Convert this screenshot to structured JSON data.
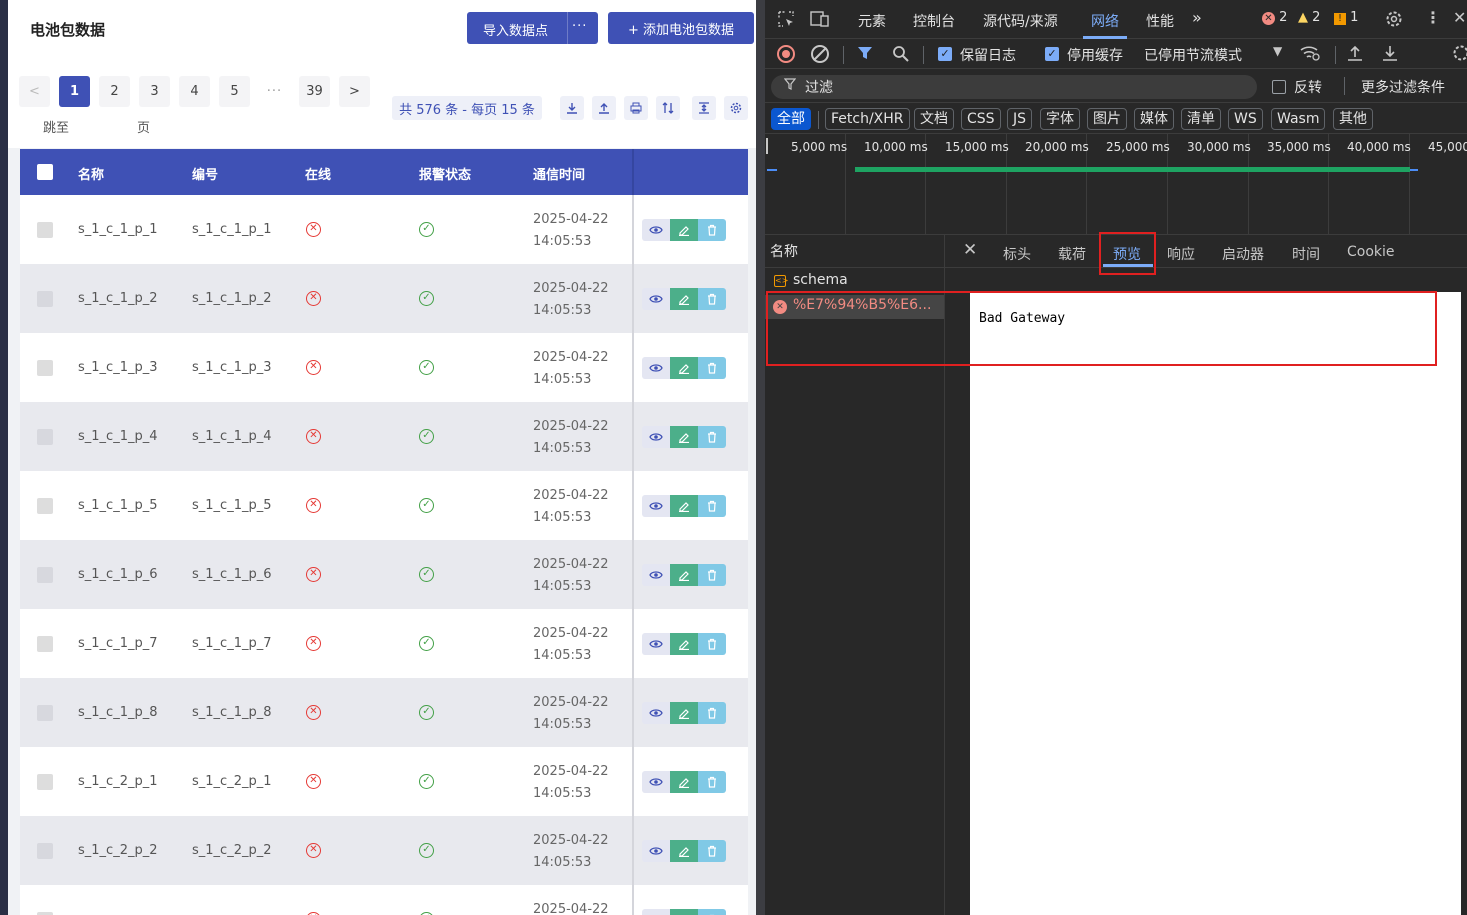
{
  "app": {
    "title": "电池包数据",
    "import_button": "导入数据点",
    "import_more": "···",
    "add_button": "+ 添加电池包数据",
    "pagination": {
      "prev": "<",
      "pages": [
        "1",
        "2",
        "3",
        "4",
        "5"
      ],
      "ellipsis": "···",
      "last_page": "39",
      "next": ">",
      "current_page": "1",
      "jump_label": "跳至",
      "page_label": "页",
      "total": "共 576 条 - 每页 15 条"
    },
    "toolbar_icons": [
      "download-icon",
      "upload-icon",
      "print-icon",
      "sort-icon",
      "column-height-icon",
      "settings-icon"
    ],
    "table": {
      "headers": [
        "名称",
        "编号",
        "在线",
        "报警状态",
        "通信时间"
      ],
      "rows": [
        {
          "name": "s_1_c_1_p_1",
          "code": "s_1_c_1_p_1",
          "date": "2025-04-22",
          "time": "14:05:53"
        },
        {
          "name": "s_1_c_1_p_2",
          "code": "s_1_c_1_p_2",
          "date": "2025-04-22",
          "time": "14:05:53"
        },
        {
          "name": "s_1_c_1_p_3",
          "code": "s_1_c_1_p_3",
          "date": "2025-04-22",
          "time": "14:05:53"
        },
        {
          "name": "s_1_c_1_p_4",
          "code": "s_1_c_1_p_4",
          "date": "2025-04-22",
          "time": "14:05:53"
        },
        {
          "name": "s_1_c_1_p_5",
          "code": "s_1_c_1_p_5",
          "date": "2025-04-22",
          "time": "14:05:53"
        },
        {
          "name": "s_1_c_1_p_6",
          "code": "s_1_c_1_p_6",
          "date": "2025-04-22",
          "time": "14:05:53"
        },
        {
          "name": "s_1_c_1_p_7",
          "code": "s_1_c_1_p_7",
          "date": "2025-04-22",
          "time": "14:05:53"
        },
        {
          "name": "s_1_c_1_p_8",
          "code": "s_1_c_1_p_8",
          "date": "2025-04-22",
          "time": "14:05:53"
        },
        {
          "name": "s_1_c_2_p_1",
          "code": "s_1_c_2_p_1",
          "date": "2025-04-22",
          "time": "14:05:53"
        },
        {
          "name": "s_1_c_2_p_2",
          "code": "s_1_c_2_p_2",
          "date": "2025-04-22",
          "time": "14:05:53"
        },
        {
          "name": "",
          "code": "",
          "date": "2025-04-22",
          "time": ""
        }
      ]
    },
    "colors": {
      "primary": "#3f51b5",
      "online_error": "#e53935",
      "alarm_ok": "#43a047",
      "edit": "#4caf8a",
      "delete": "#80c9e6"
    }
  },
  "devtools": {
    "tabs": [
      "元素",
      "控制台",
      "源代码/来源",
      "网络",
      "性能"
    ],
    "active_tab": "网络",
    "overflow": "»",
    "errors": "2",
    "warnings": "2",
    "issues": "1",
    "toolbar": {
      "preserve_log": "保留日志",
      "disable_cache": "停用缓存",
      "throttling": "已停用节流模式"
    },
    "filter": {
      "placeholder": "过滤",
      "invert": "反转",
      "more_filters": "更多过滤条件"
    },
    "types": [
      "全部",
      "Fetch/XHR",
      "文档",
      "CSS",
      "JS",
      "字体",
      "图片",
      "媒体",
      "清单",
      "WS",
      "Wasm",
      "其他"
    ],
    "active_type": "全部",
    "timeline_ticks": [
      "5,000 ms",
      "10,000 ms",
      "15,000 ms",
      "20,000 ms",
      "25,000 ms",
      "30,000 ms",
      "35,000 ms",
      "40,000 ms",
      "45,000"
    ],
    "request_list": {
      "header": "名称",
      "items": [
        {
          "name": "schema",
          "status": "ok"
        },
        {
          "name": "%E7%94%B5%E6...",
          "status": "error"
        }
      ]
    },
    "detail_tabs": [
      "标头",
      "载荷",
      "预览",
      "响应",
      "启动器",
      "时间",
      "Cookie"
    ],
    "active_detail_tab": "预览",
    "preview_body": "Bad Gateway",
    "colors": {
      "accent": "#7cacf8",
      "error": "#e02020",
      "timeline_bar": "#1ea362"
    }
  }
}
